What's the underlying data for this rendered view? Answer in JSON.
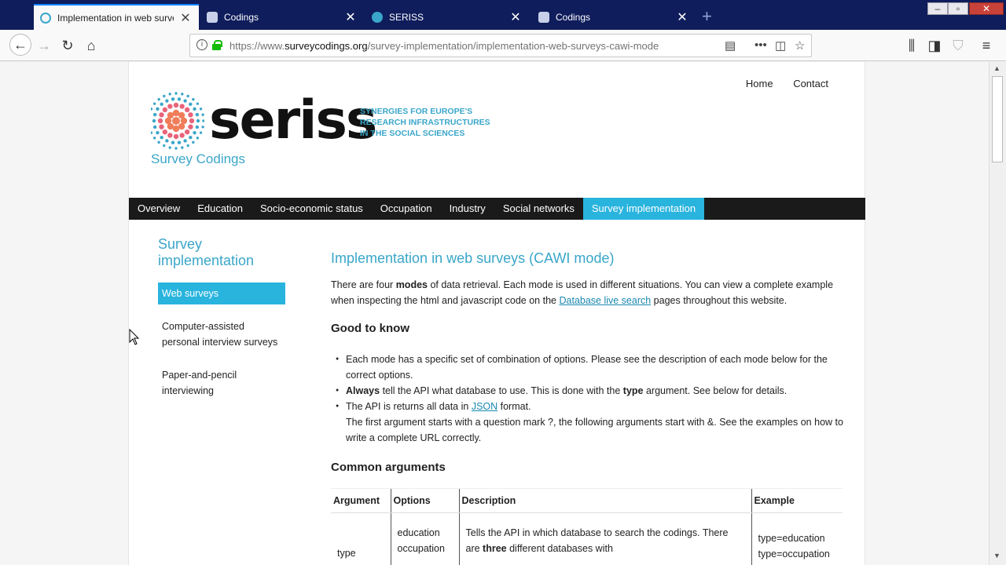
{
  "browser": {
    "tabs": [
      {
        "title": "Implementation in web surveys (CAWI mode)",
        "active": true
      },
      {
        "title": "Codings",
        "active": false
      },
      {
        "title": "SERISS",
        "active": false
      },
      {
        "title": "Codings",
        "active": false
      }
    ],
    "url_prefix": "https://www.",
    "url_host": "surveycodings.org",
    "url_path": "/survey-implementation/implementation-web-surveys-cawi-mode",
    "close_glyph": "✕",
    "new_tab_glyph": "+"
  },
  "site": {
    "top_links": {
      "home": "Home",
      "contact": "Contact"
    },
    "logo_word": "seriss",
    "logo_tagline": "Synergies for Europe's Research Infrastructures in the Social Sciences",
    "logo_sub": "Survey Codings",
    "menu": [
      {
        "label": "Overview",
        "active": false
      },
      {
        "label": "Education",
        "active": false
      },
      {
        "label": "Socio-economic status",
        "active": false
      },
      {
        "label": "Occupation",
        "active": false
      },
      {
        "label": "Industry",
        "active": false
      },
      {
        "label": "Social networks",
        "active": false
      },
      {
        "label": "Survey implementation",
        "active": true
      }
    ]
  },
  "sidebar": {
    "title": "Survey implementation",
    "items": [
      {
        "label": "Web surveys",
        "active": true
      },
      {
        "label": "Computer-assisted personal interview surveys",
        "active": false
      },
      {
        "label": "Paper-and-pencil interviewing",
        "active": false
      }
    ]
  },
  "content": {
    "title": "Implementation in web surveys (CAWI mode)",
    "intro_1": "There are four ",
    "intro_bold": "modes",
    "intro_2": " of data retrieval. Each mode is used in different situations. You can view a complete example when inspecting the html and javascript code on the ",
    "intro_link": "Database live search",
    "intro_3": " pages throughout this website.",
    "good_to_know": "Good to know",
    "bullet_1": "Each mode has a specific set of combination of options. Please see the description of each mode below for the correct options.",
    "bullet_2_bold": "Always",
    "bullet_2_a": " tell the API what database to use. This is done with the ",
    "bullet_2_bold2": "type",
    "bullet_2_b": " argument. See below for details.",
    "bullet_3_a": "The API is returns all data in ",
    "bullet_3_link": "JSON",
    "bullet_3_b": " format.",
    "bullet_3_c": "The first argument starts with a question mark ?, the following arguments start with &. See the examples on how to write a complete URL correctly.",
    "common_args": "Common arguments",
    "table": {
      "headers": [
        "Argument",
        "Options",
        "Description",
        "Example"
      ],
      "row_1": {
        "argument": "type",
        "options_1": "education",
        "options_2": "occupation",
        "desc_a": "Tells the API in which database to search the codings. There are ",
        "desc_bold": "three",
        "desc_b": " different databases with",
        "example_1": "type=education",
        "example_2": "type=occupation"
      }
    }
  }
}
